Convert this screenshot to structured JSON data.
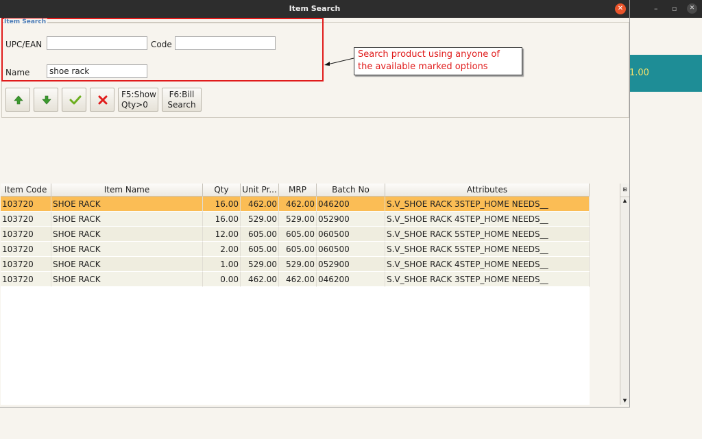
{
  "window": {
    "title": "Item Search",
    "close_icon": "✕"
  },
  "background_app": {
    "min_icon": "–",
    "max_icon": "▫",
    "close_icon": "✕",
    "teal_value": "1.00"
  },
  "search": {
    "group_label": "Item Search",
    "upc_label": "UPC/EAN",
    "upc_value": "",
    "code_label": "Code",
    "code_value": "",
    "name_label": "Name",
    "name_value": "shoe rack"
  },
  "annotation": {
    "line1": "Search product using anyone of",
    "line2": "the available marked options"
  },
  "toolbar": {
    "up_icon": "arrow-up-icon",
    "down_icon": "arrow-down-icon",
    "ok_icon": "checkmark-icon",
    "cancel_icon": "x-icon",
    "f5_line1": "F5:Show",
    "f5_line2": "Qty>0",
    "f6_line1": "F6:Bill",
    "f6_line2": "Search"
  },
  "table": {
    "headers": [
      "Item Code",
      "Item Name",
      "Qty",
      "Unit Pr...",
      "MRP",
      "Batch No",
      "Attributes"
    ],
    "rows": [
      [
        "103720",
        "SHOE RACK",
        "16.00",
        "462.00",
        "462.00",
        "046200",
        "S.V_SHOE RACK 3STEP_HOME NEEDS__"
      ],
      [
        "103720",
        "SHOE RACK",
        "16.00",
        "529.00",
        "529.00",
        "052900",
        "S.V_SHOE RACK 4STEP_HOME NEEDS__"
      ],
      [
        "103720",
        "SHOE RACK",
        "12.00",
        "605.00",
        "605.00",
        "060500",
        "S.V_SHOE RACK 5STEP_HOME NEEDS__"
      ],
      [
        "103720",
        "SHOE RACK",
        "2.00",
        "605.00",
        "605.00",
        "060500",
        "S.V_SHOE RACK 5STEP_HOME NEEDS__"
      ],
      [
        "103720",
        "SHOE RACK",
        "1.00",
        "529.00",
        "529.00",
        "052900",
        "S.V_SHOE RACK 4STEP_HOME NEEDS__"
      ],
      [
        "103720",
        "SHOE RACK",
        "0.00",
        "462.00",
        "462.00",
        "046200",
        "S.V_SHOE RACK 3STEP_HOME NEEDS__"
      ]
    ],
    "selected_row": 0
  },
  "colors": {
    "selected_row": "#fbbd55",
    "accent_red": "#e01b1b",
    "teal": "#1e8d96"
  }
}
